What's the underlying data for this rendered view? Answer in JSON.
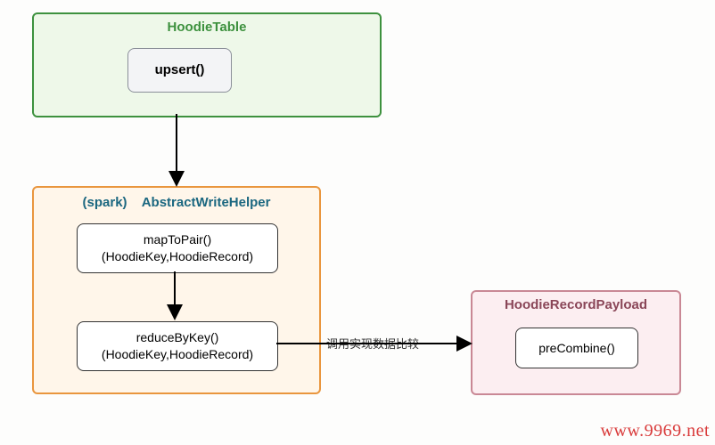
{
  "containers": {
    "hoodieTable": {
      "title": "HoodieTable"
    },
    "abstractWriteHelper": {
      "title_prefix": "(spark)",
      "title": "AbstractWriteHelper"
    },
    "hoodieRecordPayload": {
      "title": "HoodieRecordPayload"
    }
  },
  "nodes": {
    "upsert": {
      "label": "upsert()"
    },
    "mapToPair": {
      "line1": "mapToPair()",
      "line2": "(HoodieKey,HoodieRecord)"
    },
    "reduceByKey": {
      "line1": "reduceByKey()",
      "line2": "(HoodieKey,HoodieRecord)"
    },
    "preCombine": {
      "label": "preCombine()"
    }
  },
  "edges": {
    "reduceToPreCombine": "调用实现数据比较"
  },
  "watermark": "www.9969.net"
}
